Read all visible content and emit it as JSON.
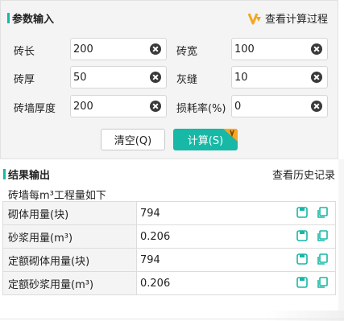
{
  "input_section": {
    "title": "参数输入",
    "view_calc_label": "查看计算过程",
    "fields": {
      "brick_length": {
        "label": "砖长",
        "value": "200"
      },
      "brick_width": {
        "label": "砖宽",
        "value": "100"
      },
      "brick_thickness": {
        "label": "砖厚",
        "value": "50"
      },
      "mortar_joint": {
        "label": "灰缝",
        "value": "10"
      },
      "wall_thickness": {
        "label": "砖墙厚度",
        "value": "200"
      },
      "loss_rate": {
        "label": "损耗率(%)",
        "value": "0"
      }
    },
    "clear_button": "清空(Q)",
    "calc_button": "计算(S)",
    "badge_text": "V"
  },
  "result_section": {
    "title": "结果输出",
    "history_label": "查看历史记录",
    "caption": "砖墙每m³工程量如下",
    "rows": [
      {
        "label": "砌体用量(块)",
        "value": "794"
      },
      {
        "label": "砂浆用量(m³)",
        "value": "0.206"
      },
      {
        "label": "定额砌体用量(块)",
        "value": "794"
      },
      {
        "label": "定额砂浆用量(m³)",
        "value": "0.206"
      }
    ]
  },
  "colors": {
    "accent": "#17b8a6",
    "badge_orange": "#f5a623",
    "panel_bg": "#f4f4f4"
  },
  "icons": [
    "clear-icon",
    "save-icon",
    "copy-icon",
    "vip-icon"
  ]
}
